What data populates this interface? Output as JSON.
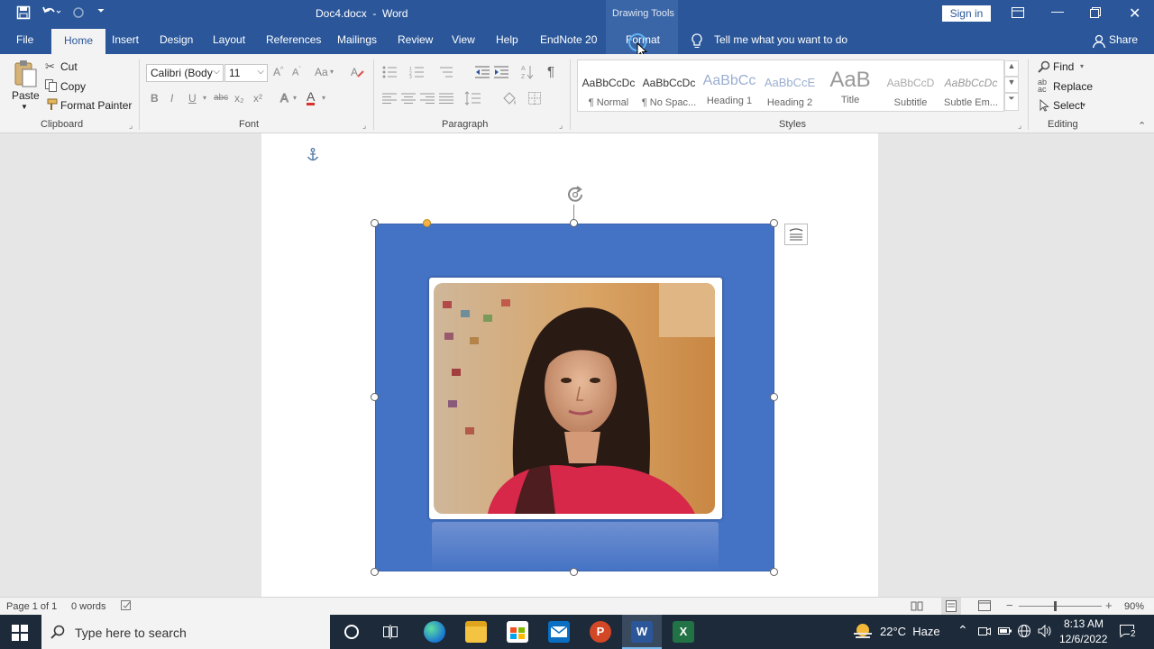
{
  "window": {
    "title": "Doc4.docx  -  Word",
    "context_tab_group": "Drawing Tools",
    "sign_in": "Sign in"
  },
  "tabs": [
    "File",
    "Home",
    "Insert",
    "Design",
    "Layout",
    "References",
    "Mailings",
    "Review",
    "View",
    "Help",
    "EndNote 20",
    "Format"
  ],
  "tell_me": "Tell me what you want to do",
  "share": "Share",
  "clipboard": {
    "paste": "Paste",
    "cut": "Cut",
    "copy": "Copy",
    "format_painter": "Format Painter",
    "label": "Clipboard"
  },
  "font": {
    "name": "Calibri (Body",
    "size": "11",
    "label": "Font",
    "aa": "Aa",
    "bold": "B",
    "italic": "I",
    "underline": "U",
    "strike": "abc",
    "sub": "x₂",
    "sup": "x²",
    "font_color_letter": "A"
  },
  "paragraph": {
    "label": "Paragraph"
  },
  "styles": {
    "label": "Styles",
    "items": [
      {
        "preview": "AaBbCcDc",
        "name": "¶ Normal"
      },
      {
        "preview": "AaBbCcDc",
        "name": "¶ No Spac..."
      },
      {
        "preview": "AaBbCc",
        "name": "Heading 1"
      },
      {
        "preview": "AaBbCcE",
        "name": "Heading 2"
      },
      {
        "preview": "AaB",
        "name": "Title"
      },
      {
        "preview": "AaBbCcD",
        "name": "Subtitle"
      },
      {
        "preview": "AaBbCcDc",
        "name": "Subtle Em..."
      }
    ]
  },
  "editing": {
    "find": "Find",
    "replace": "Replace",
    "select": "Select",
    "label": "Editing"
  },
  "status": {
    "page": "Page 1 of 1",
    "words": "0 words",
    "zoom": "90%"
  },
  "taskbar": {
    "search_placeholder": "Type here to search",
    "weather": "22°C  Haze",
    "time": "8:13 AM",
    "date": "12/6/2022",
    "notifications": "2"
  },
  "colors": {
    "word_blue": "#2b579a",
    "shape_fill": "#4472c4",
    "ribbon_bg": "#f3f3f3"
  }
}
